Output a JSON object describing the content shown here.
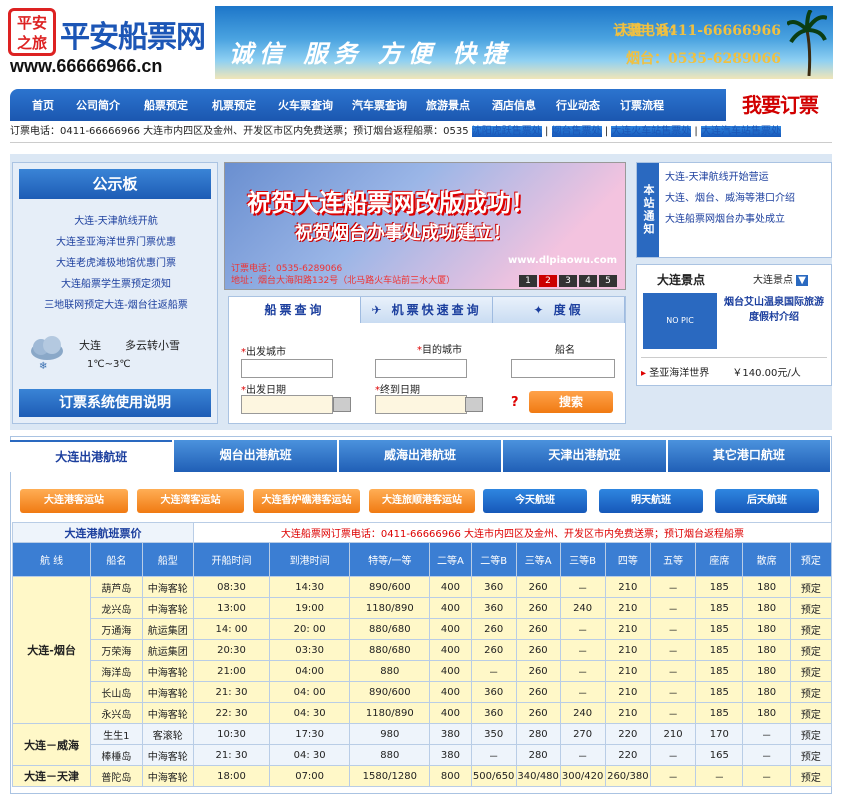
{
  "header": {
    "logo_seal": "平安之旅",
    "logo_name": "平安船票网",
    "logo_url": "www.66666966.cn",
    "slogan": "诚信 服务 方便 快捷",
    "phone_label": "订票电话：",
    "phone_dl": "大连：0411-66666966",
    "phone_yt": "烟台：0535-6289066"
  },
  "nav": {
    "items": [
      "首页",
      "公司简介",
      "船票预定",
      "机票预定",
      "火车票查询",
      "汽车票查询",
      "旅游景点",
      "酒店信息",
      "行业动态",
      "订票流程"
    ],
    "order_label": "我要订票"
  },
  "ticker": {
    "text": "订票电话：0411-66666966 大连市内四区及金州、开发区市区内免费送票；预订烟台返程船票：0535",
    "links": [
      "沈阳虎跃售票处",
      "烟台售票处",
      "大连火车站售票处",
      "大连汽车站售票处"
    ]
  },
  "notice_board": {
    "title": "公示板",
    "items": [
      "大连-天津航线开航",
      "大连圣亚海洋世界门票优惠",
      "大连老虎滩极地馆优惠门票",
      "大连船票学生票预定须知",
      "三地联网预定大连-烟台往返船票"
    ],
    "weather_city": "大连",
    "weather_desc": "多云转小雪",
    "weather_temp": "1℃~3℃",
    "guide_label": "订票系统使用说明"
  },
  "promo": {
    "line1": "祝贺大连船票网改版成功！",
    "line2": "祝贺烟台办事处成功建立！",
    "line3": "订票电话：0535-6289066",
    "line4": "地址：烟台大海阳路132号（北马路火车站前三水大厦）",
    "site": "www.dlpiaowu.com",
    "pages": [
      "1",
      "2",
      "3",
      "4",
      "5"
    ]
  },
  "search": {
    "tabs": [
      "船票查询",
      "机票快速查询",
      "度假"
    ],
    "from_city_label": "出发城市",
    "to_city_label": "目的城市",
    "ship_label": "船名",
    "depart_date_label": "出发日期",
    "arrive_date_label": "终到日期",
    "submit_label": "搜索"
  },
  "site_notice": {
    "tab_label": "本站通知",
    "items": [
      "大连-天津航线开始营运",
      "大连、烟台、威海等港口介绍",
      "大连船票网烟台办事处成立"
    ]
  },
  "scenic": {
    "title": "大连景点",
    "select_value": "大连景点",
    "no_pic": "NO PIC",
    "feature": "烟台艾山温泉国际旅游度假村介绍",
    "item_name": "圣亚海洋世界",
    "item_price": "￥140.00元/人"
  },
  "routes": {
    "tabs": [
      "大连出港航班",
      "烟台出港航班",
      "威海出港航班",
      "天津出港航班",
      "其它港口航班"
    ],
    "stations": [
      "大连港客运站",
      "大连湾客运站",
      "大连香炉礁港客运站",
      "大连旅顺港客运站"
    ],
    "days": [
      "今天航班",
      "明天航班",
      "后天航班"
    ],
    "price_title": "大连港航班票价",
    "price_notice": "大连船票网订票电话：0411-66666966 大连市内四区及金州、开发区市内免费送票；预订烟台返程船票",
    "headers": [
      "航 线",
      "船名",
      "船型",
      "开船时间",
      "到港时间",
      "特等/一等",
      "二等A",
      "二等B",
      "三等A",
      "三等B",
      "四等",
      "五等",
      "座席",
      "散席",
      "预定"
    ],
    "groups": [
      {
        "route": "大连-烟台",
        "rows": [
          [
            "葫芦岛",
            "中海客轮",
            "08:30",
            "14:30",
            "890/600",
            "400",
            "360",
            "260",
            "－",
            "210",
            "－",
            "185",
            "180",
            "预定"
          ],
          [
            "龙兴岛",
            "中海客轮",
            "13:00",
            "19:00",
            "1180/890",
            "400",
            "360",
            "260",
            "240",
            "210",
            "－",
            "185",
            "180",
            "预定"
          ],
          [
            "万通海",
            "航运集团",
            "14: 00",
            "20: 00",
            "880/680",
            "400",
            "260",
            "260",
            "－",
            "210",
            "－",
            "185",
            "180",
            "预定"
          ],
          [
            "万荣海",
            "航运集团",
            "20:30",
            "03:30",
            "880/680",
            "400",
            "260",
            "260",
            "－",
            "210",
            "－",
            "185",
            "180",
            "预定"
          ],
          [
            "海洋岛",
            "中海客轮",
            "21:00",
            "04:00",
            "880",
            "400",
            "－",
            "260",
            "－",
            "210",
            "－",
            "185",
            "180",
            "预定"
          ],
          [
            "长山岛",
            "中海客轮",
            "21: 30",
            "04: 00",
            "890/600",
            "400",
            "360",
            "260",
            "－",
            "210",
            "－",
            "185",
            "180",
            "预定"
          ],
          [
            "永兴岛",
            "中海客轮",
            "22: 30",
            "04: 30",
            "1180/890",
            "400",
            "360",
            "260",
            "240",
            "210",
            "－",
            "185",
            "180",
            "预定"
          ]
        ]
      },
      {
        "route": "大连－威海",
        "rows": [
          [
            "生生1",
            "客滚轮",
            "10:30",
            "17:30",
            "980",
            "380",
            "350",
            "280",
            "270",
            "220",
            "210",
            "170",
            "－",
            "预定"
          ],
          [
            "棒棰岛",
            "中海客轮",
            "21: 30",
            "04: 30",
            "880",
            "380",
            "－",
            "280",
            "－",
            "220",
            "－",
            "165",
            "－",
            "预定"
          ]
        ]
      },
      {
        "route": "大连－天津",
        "rows": [
          [
            "普陀岛",
            "中海客轮",
            "18:00",
            "07:00",
            "1580/1280",
            "800",
            "500/650",
            "340/480",
            "300/420",
            "260/380",
            "－",
            "－",
            "－",
            "预定"
          ]
        ]
      }
    ]
  },
  "colors": {
    "brand_blue": "#1c56b6",
    "accent_red": "#d10000",
    "orange": "#f07a12",
    "row_yellow": "#fff8c8"
  }
}
